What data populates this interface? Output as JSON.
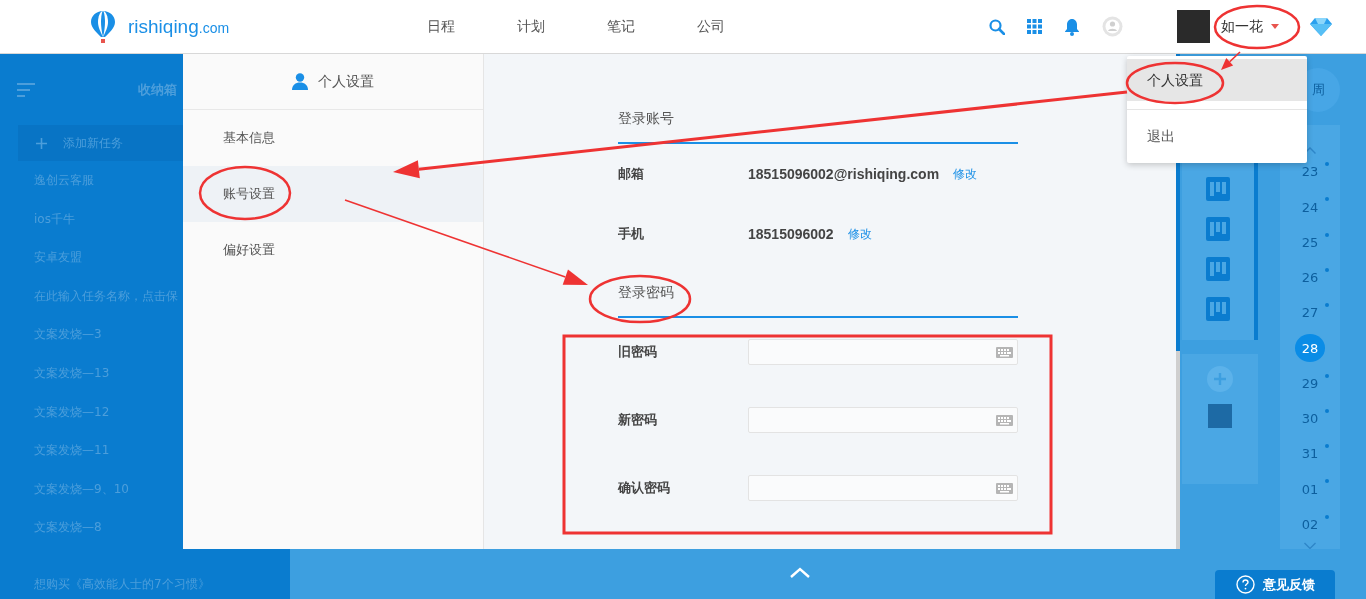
{
  "header": {
    "logo": {
      "name": "rishiqing",
      "suffix": ".com"
    },
    "nav": [
      {
        "label": "日程"
      },
      {
        "label": "计划"
      },
      {
        "label": "笔记"
      },
      {
        "label": "公司"
      }
    ],
    "user": {
      "name": "如一花"
    }
  },
  "dropdown": {
    "items": [
      {
        "label": "个人设置",
        "selected": true
      },
      {
        "label": "退出",
        "selected": false
      }
    ]
  },
  "background_sidebar": {
    "title": "收纳箱",
    "add_task": "添加新任务",
    "items": [
      "逸创云客服",
      "ios千牛",
      "安卓友盟",
      "在此输入任务名称，点击保",
      "文案发烧—3",
      "文案发烧—13",
      "文案发烧—12",
      "文案发烧—11",
      "文案发烧—9、10",
      "文案发烧—8"
    ],
    "footer_item": "想购买《高效能人士的7个习惯》"
  },
  "settings_panel": {
    "title": "个人设置",
    "nav": [
      {
        "label": "基本信息",
        "selected": false
      },
      {
        "label": "账号设置",
        "selected": true
      },
      {
        "label": "偏好设置",
        "selected": false
      }
    ],
    "sections": [
      {
        "title": "登录账号",
        "rows": [
          {
            "kind": "info",
            "label": "邮箱",
            "value": "18515096002@rishiqing.com",
            "action": "修改"
          },
          {
            "kind": "info",
            "label": "手机",
            "value": "18515096002",
            "action": "修改"
          }
        ]
      },
      {
        "title": "登录密码",
        "rows": [
          {
            "kind": "password",
            "label": "旧密码"
          },
          {
            "kind": "password",
            "label": "新密码"
          },
          {
            "kind": "password",
            "label": "确认密码"
          }
        ]
      }
    ]
  },
  "right_strip": {
    "view_button": "周",
    "dates": [
      {
        "label": "23",
        "selected": false
      },
      {
        "label": "24",
        "selected": false
      },
      {
        "label": "25",
        "selected": false
      },
      {
        "label": "26",
        "selected": false
      },
      {
        "label": "27",
        "selected": false
      },
      {
        "label": "28",
        "selected": true
      },
      {
        "label": "29",
        "selected": false
      },
      {
        "label": "30",
        "selected": false
      },
      {
        "label": "31",
        "selected": false
      },
      {
        "label": "01",
        "selected": false
      },
      {
        "label": "02",
        "selected": false
      }
    ]
  },
  "bottom_bar": {
    "feedback": "意见反馈"
  }
}
